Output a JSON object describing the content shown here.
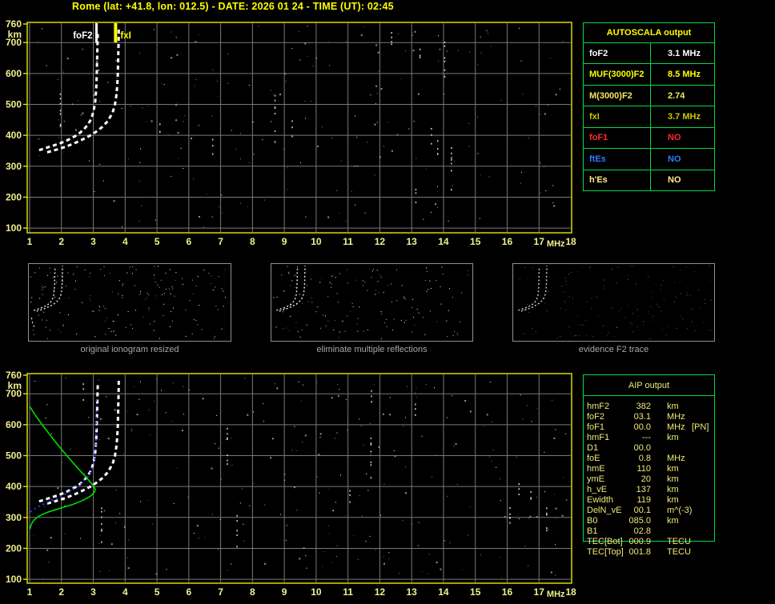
{
  "title": "Rome (lat: +41.8, lon: 012.5) - DATE: 2026 01 24 - TIME (UT): 02:45",
  "colors": {
    "background": "#000000",
    "title": "#ffff00",
    "plot_frame": "#e8e800",
    "grid": "#787878",
    "axis_text": "#f0ef8f",
    "trace_white": "#ffffff",
    "profile_green": "#00dd00",
    "restored_blue": "#2936ff",
    "panel_border": "#909090",
    "caption_gray": "#a8a8a8",
    "table_border": "#00d84a",
    "aip_text": "#efe97a",
    "marker_foF2": "#ffffff",
    "marker_fxI": "#ffff00"
  },
  "autoscala": {
    "header": "AUTOSCALA output",
    "rows": [
      {
        "label": "foF2",
        "value": "3.1 MHz",
        "color": "#ffffff"
      },
      {
        "label": "MUF(3000)F2",
        "value": "8.5 MHz",
        "color": "#ffff00"
      },
      {
        "label": "M(3000)F2",
        "value": "2.74",
        "color": "#f2e95e"
      },
      {
        "label": "fxI",
        "value": "3.7 MHz",
        "color": "#c9c900"
      },
      {
        "label": "foF1",
        "value": "NO",
        "color": "#ff2a2a"
      },
      {
        "label": "ftEs",
        "value": "NO",
        "color": "#2f7bff"
      },
      {
        "label": "h'Es",
        "value": "NO",
        "color": "#ffee8e"
      }
    ]
  },
  "aip": {
    "header": "AIP output",
    "rows": [
      {
        "label": "hmF2",
        "value": "382",
        "unit": "km",
        "extra": ""
      },
      {
        "label": "foF2",
        "value": "03.1",
        "unit": "MHz",
        "extra": ""
      },
      {
        "label": "foF1",
        "value": "00.0",
        "unit": "MHz",
        "extra": "[PN]"
      },
      {
        "label": "hmF1",
        "value": "---",
        "unit": "km",
        "extra": ""
      },
      {
        "label": "D1",
        "value": "00.0",
        "unit": "",
        "extra": ""
      },
      {
        "label": "foE",
        "value": "0.8",
        "unit": "MHz",
        "extra": ""
      },
      {
        "label": "hmE",
        "value": "110",
        "unit": "km",
        "extra": ""
      },
      {
        "label": "ymE",
        "value": "20",
        "unit": "km",
        "extra": ""
      },
      {
        "label": "h_vE",
        "value": "137",
        "unit": "km",
        "extra": ""
      },
      {
        "label": "Ewidth",
        "value": "119",
        "unit": "km",
        "extra": ""
      },
      {
        "label": "DelN_vE",
        "value": "00.1",
        "unit": "m^(-3)",
        "extra": ""
      },
      {
        "label": "B0",
        "value": "085.0",
        "unit": "km",
        "extra": ""
      },
      {
        "label": "B1",
        "value": "02.8",
        "unit": "",
        "extra": ""
      },
      {
        "label": "TEC[Bot]",
        "value": "000.9",
        "unit": "TECU",
        "extra": ""
      },
      {
        "label": "TEC[Top]",
        "value": "001.8",
        "unit": "TECU",
        "extra": ""
      }
    ]
  },
  "panels": [
    {
      "caption": "original ionogram resized"
    },
    {
      "caption": "eliminate multiple reflections"
    },
    {
      "caption": "evidence F2 trace"
    }
  ],
  "noise": {
    "plot_seeds": [
      101,
      202
    ],
    "plot_dots": [
      230,
      260
    ],
    "panel_seeds": [
      11,
      22,
      33
    ],
    "panel_dots": [
      170,
      150,
      135
    ]
  },
  "chart_data": [
    {
      "id": "top_ionogram",
      "type": "scatter",
      "title": "",
      "xlabel": "MHz",
      "ylabel": "km",
      "xlim": [
        1,
        18
      ],
      "ylim": [
        100,
        760
      ],
      "x_ticks": [
        1,
        2,
        3,
        4,
        5,
        6,
        7,
        8,
        9,
        10,
        11,
        12,
        13,
        14,
        15,
        16,
        17,
        18
      ],
      "y_ticks": [
        760,
        700,
        600,
        500,
        400,
        300,
        200,
        100
      ],
      "grid": true,
      "markers": [
        {
          "name": "foF2",
          "label": "foF2",
          "f": 3.1,
          "color": "#ffffff",
          "side": "left"
        },
        {
          "name": "fxI",
          "label": "fxI",
          "f": 3.7,
          "color": "#ffff00",
          "side": "right"
        }
      ],
      "series": [
        {
          "name": "o-mode-trace",
          "style": "trace",
          "points": [
            [
              1.3,
              352
            ],
            [
              1.45,
              357
            ],
            [
              1.6,
              362
            ],
            [
              1.78,
              368
            ],
            [
              1.95,
              374
            ],
            [
              2.12,
              381
            ],
            [
              2.28,
              389
            ],
            [
              2.44,
              398
            ],
            [
              2.58,
              408
            ],
            [
              2.7,
              419
            ],
            [
              2.81,
              432
            ],
            [
              2.9,
              447
            ],
            [
              2.97,
              464
            ],
            [
              3.02,
              484
            ],
            [
              3.06,
              508
            ],
            [
              3.08,
              535
            ],
            [
              3.1,
              568
            ],
            [
              3.11,
              605
            ],
            [
              3.12,
              645
            ],
            [
              3.13,
              688
            ],
            [
              3.14,
              728
            ]
          ]
        },
        {
          "name": "x-mode-trace",
          "style": "trace",
          "points": [
            [
              1.55,
              345
            ],
            [
              1.75,
              351
            ],
            [
              1.95,
              357
            ],
            [
              2.15,
              364
            ],
            [
              2.35,
              372
            ],
            [
              2.55,
              381
            ],
            [
              2.75,
              391
            ],
            [
              2.95,
              402
            ],
            [
              3.12,
              414
            ],
            [
              3.28,
              427
            ],
            [
              3.42,
              442
            ],
            [
              3.53,
              459
            ],
            [
              3.62,
              478
            ],
            [
              3.68,
              500
            ],
            [
              3.72,
              527
            ],
            [
              3.75,
              558
            ],
            [
              3.77,
              595
            ],
            [
              3.78,
              635
            ],
            [
              3.79,
              678
            ],
            [
              3.8,
              722
            ],
            [
              3.8,
              752
            ]
          ]
        }
      ]
    },
    {
      "id": "bottom_ionogram_aip",
      "type": "scatter",
      "title": "",
      "xlabel": "MHz",
      "ylabel": "km",
      "xlim": [
        1,
        18
      ],
      "ylim": [
        100,
        760
      ],
      "x_ticks": [
        1,
        2,
        3,
        4,
        5,
        6,
        7,
        8,
        9,
        10,
        11,
        12,
        13,
        14,
        15,
        16,
        17,
        18
      ],
      "y_ticks": [
        760,
        700,
        600,
        500,
        400,
        300,
        200,
        100
      ],
      "grid": true,
      "markers": [],
      "series": [
        {
          "name": "o-mode-trace",
          "style": "trace",
          "points": [
            [
              1.3,
              352
            ],
            [
              1.45,
              357
            ],
            [
              1.6,
              362
            ],
            [
              1.78,
              368
            ],
            [
              1.95,
              374
            ],
            [
              2.12,
              381
            ],
            [
              2.28,
              389
            ],
            [
              2.44,
              398
            ],
            [
              2.58,
              408
            ],
            [
              2.7,
              419
            ],
            [
              2.81,
              432
            ],
            [
              2.9,
              447
            ],
            [
              2.97,
              464
            ],
            [
              3.02,
              484
            ],
            [
              3.06,
              508
            ],
            [
              3.08,
              535
            ],
            [
              3.1,
              568
            ],
            [
              3.11,
              605
            ],
            [
              3.12,
              645
            ],
            [
              3.13,
              688
            ],
            [
              3.14,
              728
            ]
          ]
        },
        {
          "name": "x-mode-trace",
          "style": "trace",
          "points": [
            [
              1.55,
              345
            ],
            [
              1.75,
              351
            ],
            [
              1.95,
              357
            ],
            [
              2.15,
              364
            ],
            [
              2.35,
              372
            ],
            [
              2.55,
              381
            ],
            [
              2.75,
              391
            ],
            [
              2.95,
              402
            ],
            [
              3.12,
              414
            ],
            [
              3.28,
              427
            ],
            [
              3.42,
              442
            ],
            [
              3.53,
              459
            ],
            [
              3.62,
              478
            ],
            [
              3.68,
              500
            ],
            [
              3.72,
              527
            ],
            [
              3.75,
              558
            ],
            [
              3.77,
              595
            ],
            [
              3.78,
              635
            ],
            [
              3.79,
              678
            ],
            [
              3.8,
              722
            ],
            [
              3.8,
              752
            ]
          ]
        },
        {
          "name": "electron-density-profile",
          "style": "profile",
          "points": [
            [
              1.0,
              659
            ],
            [
              1.15,
              635
            ],
            [
              1.35,
              606
            ],
            [
              1.6,
              572
            ],
            [
              1.9,
              533
            ],
            [
              2.2,
              496
            ],
            [
              2.48,
              463
            ],
            [
              2.72,
              436
            ],
            [
              2.9,
              415
            ],
            [
              3.02,
              400
            ],
            [
              3.06,
              391
            ],
            [
              3.04,
              383
            ],
            [
              2.95,
              372
            ],
            [
              2.8,
              362
            ],
            [
              2.6,
              352
            ],
            [
              2.35,
              342
            ],
            [
              2.1,
              334
            ],
            [
              1.85,
              326
            ],
            [
              1.6,
              318
            ],
            [
              1.38,
              309
            ],
            [
              1.2,
              298
            ],
            [
              1.1,
              287
            ],
            [
              1.04,
              274
            ],
            [
              1.01,
              262
            ]
          ]
        },
        {
          "name": "restored-o-trace",
          "style": "restored",
          "points": [
            [
              1.02,
              318
            ],
            [
              1.15,
              327
            ],
            [
              1.3,
              336
            ],
            [
              1.48,
              345
            ],
            [
              1.66,
              354
            ],
            [
              1.84,
              362
            ],
            [
              2.02,
              371
            ],
            [
              2.2,
              380
            ],
            [
              2.38,
              391
            ],
            [
              2.54,
              402
            ],
            [
              2.68,
              414
            ],
            [
              2.8,
              427
            ],
            [
              2.89,
              441
            ],
            [
              2.96,
              457
            ],
            [
              3.01,
              474
            ],
            [
              3.05,
              494
            ],
            [
              3.07,
              515
            ],
            [
              3.09,
              545
            ],
            [
              3.1,
              575
            ]
          ]
        },
        {
          "name": "restored-dots",
          "style": "restored_dots",
          "points": [
            [
              3.08,
              548
            ],
            [
              3.1,
              648
            ],
            [
              3.1,
              690
            ]
          ]
        }
      ]
    }
  ],
  "panel_extra_trace": [
    [
      1.1,
      285
    ],
    [
      1.14,
      258
    ],
    [
      1.2,
      232
    ],
    [
      1.3,
      210
    ],
    [
      1.48,
      196
    ]
  ]
}
